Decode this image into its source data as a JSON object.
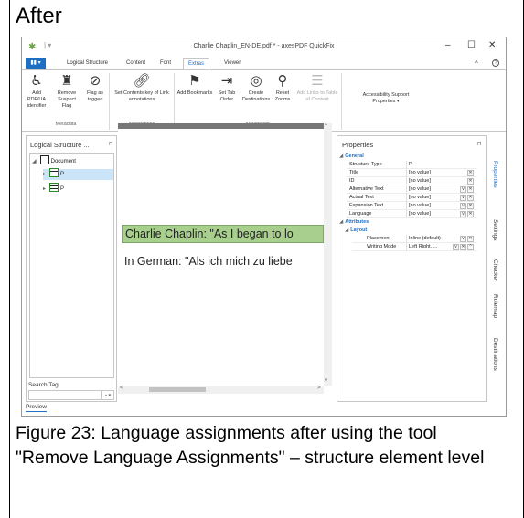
{
  "heading": "After",
  "window": {
    "title": "Charlie Chaplin_EN-DE.pdf * - axesPDF QuickFix",
    "minimize": "–",
    "maximize": "☐",
    "close": "✕",
    "collapse": "^",
    "help": "?"
  },
  "ribbon": {
    "file_tab": "▮▮ ▾",
    "tabs": [
      "Logical Structure",
      "Content",
      "Font",
      "Extras",
      "Viewer"
    ],
    "active_tab": "Extras",
    "buttons": {
      "add_pdfua": "Add PDF/UA identifier",
      "remove_suspect": "Remove Suspect Flag",
      "flag_tagged": "Flag as tagged",
      "set_contents_key": "Set Contents key of Link annotations",
      "add_bookmarks": "Add Bookmarks",
      "set_tab_order": "Set Tab Order",
      "create_destinations": "Create Destinations",
      "reset_zooms": "Reset Zooms",
      "add_links_toc": "Add Links to Table of Content",
      "accessibility_support": "Accessibility Support Properties ▾"
    },
    "groups": {
      "metadata": "Metadata",
      "annotations": "Annotations",
      "navigation": "Navigation"
    }
  },
  "logical_structure": {
    "title": "Logical Structure ...",
    "pin": "⊓",
    "tree": {
      "root": "Document",
      "children": [
        "P",
        "P"
      ]
    },
    "search_label": "Search Tag",
    "search_value": "",
    "spin": "▴ ▾"
  },
  "preview": {
    "line1": "Charlie Chaplin: \"As I began to lo",
    "line2": "In German: \"Als ich mich zu liebe",
    "tab": "Preview"
  },
  "properties": {
    "title": "Properties",
    "pin": "⊓",
    "general_section": "General",
    "rows": [
      {
        "key": "Structure Type",
        "value": "P",
        "buttons": ""
      },
      {
        "key": "Title",
        "value": "[no value]",
        "buttons": "x"
      },
      {
        "key": "ID",
        "value": "[no value]",
        "buttons": "x"
      },
      {
        "key": "Alternative Text",
        "value": "[no value]",
        "buttons": "vx"
      },
      {
        "key": "Actual Text",
        "value": "[no value]",
        "buttons": "vx"
      },
      {
        "key": "Expansion Text",
        "value": "[no value]",
        "buttons": "vx"
      },
      {
        "key": "Language",
        "value": "[no value]",
        "buttons": "vx"
      }
    ],
    "attributes_section": "Attributes",
    "layout_section": "Layout",
    "layout_rows": [
      {
        "key": "Placement",
        "value": "Inline (default)",
        "buttons": "vx"
      },
      {
        "key": "Writing Mode",
        "value": "Left Right, ...",
        "buttons": "vx^"
      }
    ]
  },
  "side_tabs": [
    "Properties",
    "Settings",
    "Checker",
    "Rolemap",
    "Destinations"
  ],
  "caption": "Figure 23: Language assignments after using the tool \"Remove Language Assignments\" – structure element level"
}
